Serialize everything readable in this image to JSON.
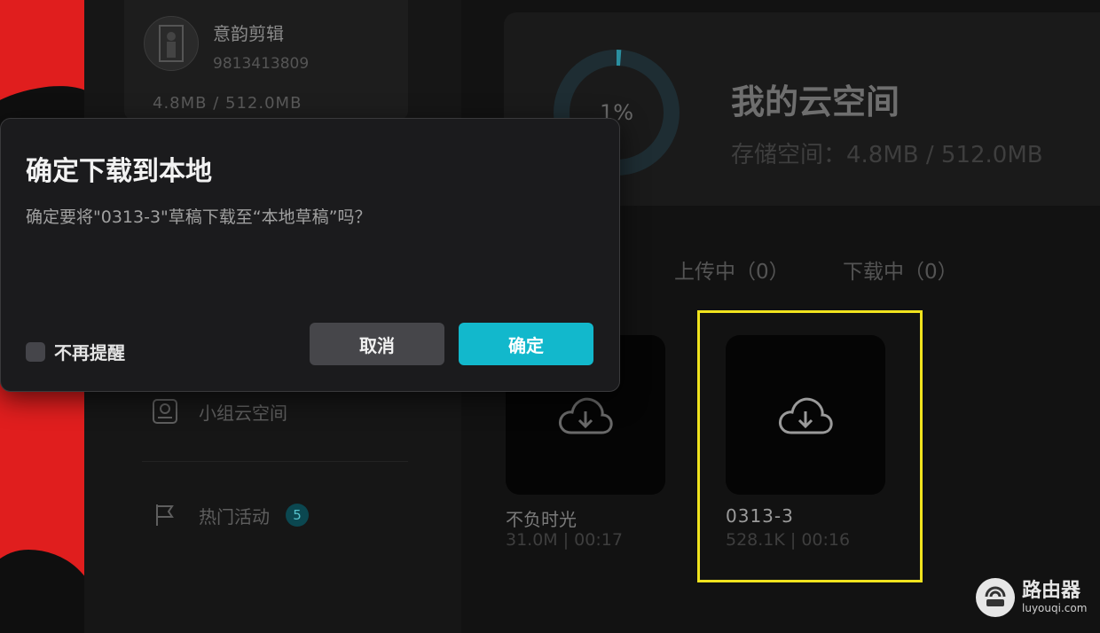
{
  "profile": {
    "username": "意韵剪辑",
    "user_id": "9813413809",
    "storage": "4.8MB / 512.0MB"
  },
  "nav": {
    "team_cloud": "小组云空间",
    "hot_events": "热门活动",
    "hot_events_badge": "5"
  },
  "cloud_header": {
    "percent": "1%",
    "percent_value": 0.01,
    "title": "我的云空间",
    "storage_line": "存储空间：4.8MB / 512.0MB"
  },
  "tabs": {
    "uploading": "上传中（0）",
    "downloading": "下载中（0）"
  },
  "drafts": [
    {
      "name": "不负时光",
      "meta": "31.0M | 00:17",
      "icon": "cloud-download-icon"
    },
    {
      "name": "0313-3",
      "meta": "528.1K | 00:16",
      "icon": "cloud-download-icon"
    }
  ],
  "dialog": {
    "title": "确定下载到本地",
    "message": "确定要将\"0313-3\"草稿下载至“本地草稿”吗？",
    "checkbox_label": "不再提醒",
    "cancel_label": "取消",
    "confirm_label": "确定"
  },
  "watermark": {
    "main": "路由器",
    "sub": "luyouqi.com"
  },
  "colors": {
    "accent": "#12b8cc",
    "highlight": "#f0e31e",
    "red_strip": "#e01e1e"
  }
}
